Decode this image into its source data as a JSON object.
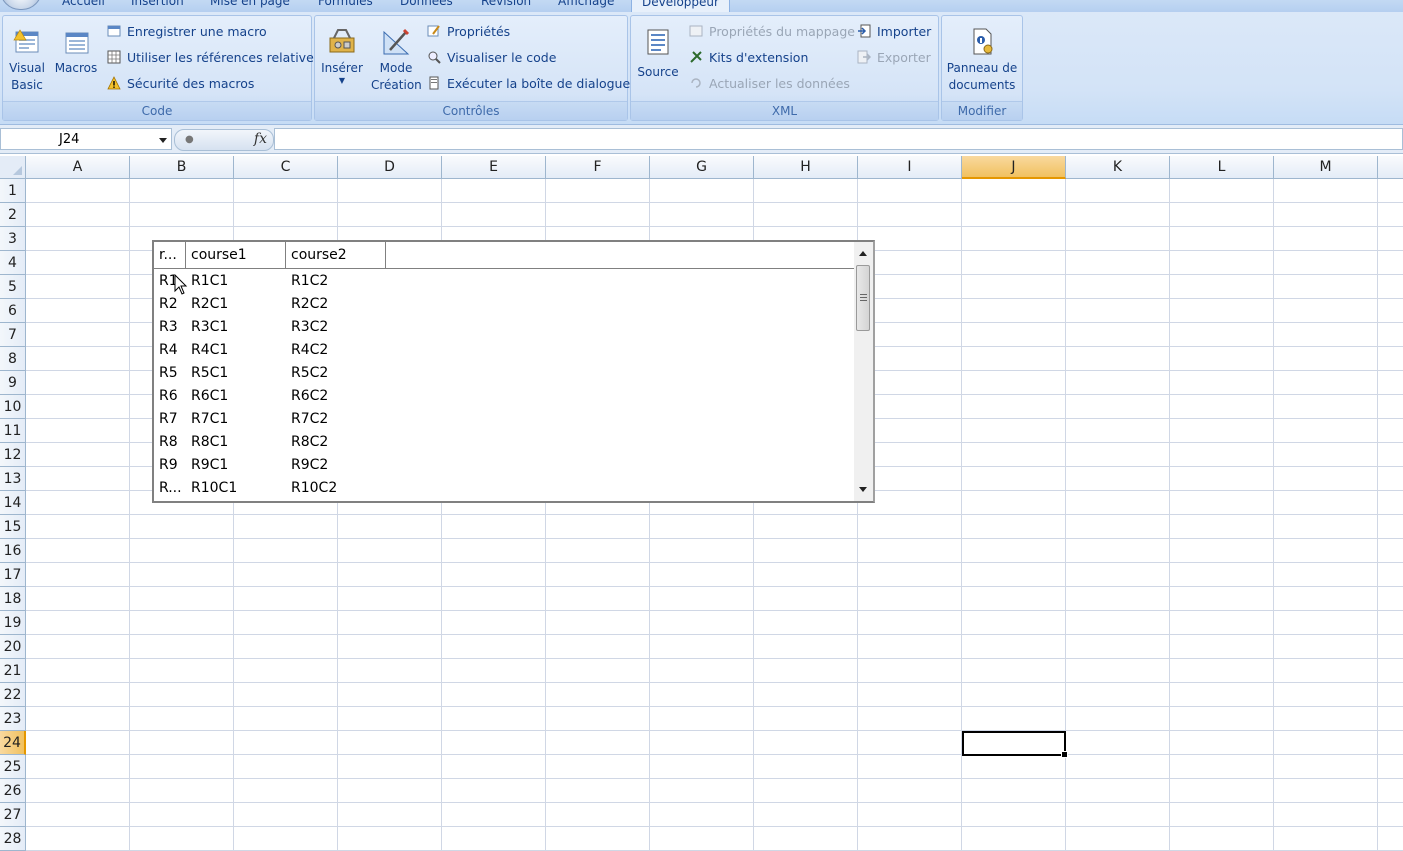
{
  "ribbon": {
    "tabs": [
      "Accueil",
      "Insertion",
      "Mise en page",
      "Formules",
      "Données",
      "Révision",
      "Affichage",
      "Développeur"
    ],
    "active_tab": "Développeur",
    "groups": {
      "code": {
        "title": "Code",
        "visual_basic": [
          "Visual",
          "Basic"
        ],
        "macros": "Macros",
        "record_macro": "Enregistrer une macro",
        "relative_refs": "Utiliser les références relatives",
        "macro_security": "Sécurité des macros"
      },
      "controls": {
        "title": "Contrôles",
        "insert": "Insérer",
        "design_mode": [
          "Mode",
          "Création"
        ],
        "properties": "Propriétés",
        "view_code": "Visualiser le code",
        "run_dialog": "Exécuter la boîte de dialogue"
      },
      "xml": {
        "title": "XML",
        "source": "Source",
        "map_properties": "Propriétés du mappage",
        "expansion_packs": "Kits d'extension",
        "refresh_data": "Actualiser les données",
        "import": "Importer",
        "export": "Exporter"
      },
      "modify": {
        "title": "Modifier",
        "document_panel": [
          "Panneau de",
          "documents"
        ]
      }
    }
  },
  "formula_bar": {
    "name_box": "J24",
    "fx": "fx",
    "formula": ""
  },
  "sheet": {
    "columns": [
      "A",
      "B",
      "C",
      "D",
      "E",
      "F",
      "G",
      "H",
      "I",
      "J",
      "K",
      "L",
      "M"
    ],
    "rows": [
      "1",
      "2",
      "3",
      "4",
      "5",
      "6",
      "7",
      "8",
      "9",
      "10",
      "11",
      "12",
      "13",
      "14",
      "15",
      "16",
      "17",
      "18",
      "19",
      "20",
      "21",
      "22",
      "23",
      "24",
      "25",
      "26",
      "27",
      "28"
    ],
    "selected_column": "J",
    "selected_row": "24"
  },
  "listbox": {
    "headers": [
      "r...",
      "course1",
      "course2",
      ""
    ],
    "rows": [
      [
        "R1",
        "R1C1",
        "R1C2"
      ],
      [
        "R2",
        "R2C1",
        "R2C2"
      ],
      [
        "R3",
        "R3C1",
        "R3C2"
      ],
      [
        "R4",
        "R4C1",
        "R4C2"
      ],
      [
        "R5",
        "R5C1",
        "R5C2"
      ],
      [
        "R6",
        "R6C1",
        "R6C2"
      ],
      [
        "R7",
        "R7C1",
        "R7C2"
      ],
      [
        "R8",
        "R8C1",
        "R8C2"
      ],
      [
        "R9",
        "R9C1",
        "R9C2"
      ],
      [
        "R...",
        "R10C1",
        "R10C2"
      ]
    ]
  }
}
